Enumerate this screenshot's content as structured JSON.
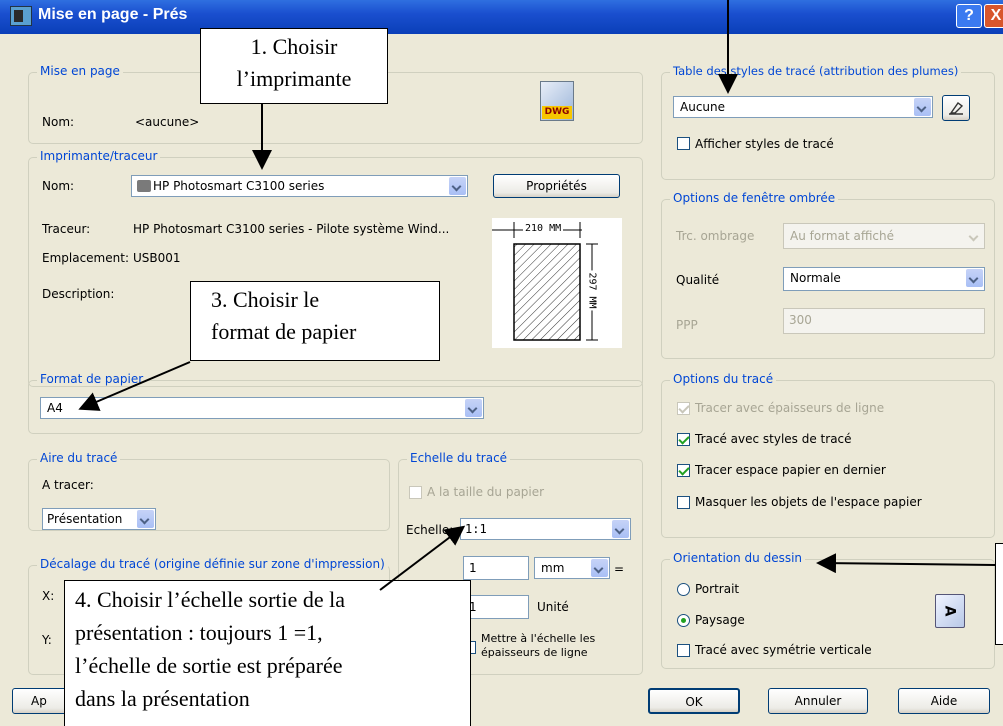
{
  "window": {
    "title": "Mise en page - Prés",
    "help_label": "?",
    "close_label": "X"
  },
  "mise_en_page": {
    "legend": "Mise en page",
    "nom_label": "Nom:",
    "nom_value": "<aucune>",
    "dwg_label": "DWG"
  },
  "imprimante": {
    "legend": "Imprimante/traceur",
    "nom_label": "Nom:",
    "nom_value": "HP Photosmart C3100 series",
    "proprietes_label": "Propriétés",
    "traceur_label": "Traceur:",
    "traceur_value": "HP Photosmart C3100 series - Pilote système Wind...",
    "emplacement_label": "Emplacement:",
    "emplacement_value": "USB001",
    "description_label": "Description:",
    "paper_width_label": "210 MM",
    "paper_height_label": "297 MM"
  },
  "format_papier": {
    "legend": "Format de papier",
    "value": "A4"
  },
  "aire_trace": {
    "legend": "Aire du tracé",
    "a_tracer_label": "A tracer:",
    "value": "Présentation"
  },
  "decalage": {
    "legend": "Décalage du tracé (origine définie sur zone d'impression)",
    "x_label": "X:",
    "y_label": "Y:"
  },
  "echelle": {
    "legend": "Echelle du tracé",
    "taille_papier_label": "A la taille du papier",
    "echelle_label": "Echelle:",
    "echelle_value": "1:1",
    "num_value": "1",
    "unit_value": "mm",
    "equals": "=",
    "den_value": "1",
    "unite_label": "Unité",
    "mettre_label_1": "Mettre à l'échelle les",
    "mettre_label_2": "épaisseurs de ligne"
  },
  "table_styles": {
    "legend": "Table des styles de tracé (attribution des plumes)",
    "value": "Aucune",
    "afficher_label": "Afficher styles de tracé"
  },
  "ombree": {
    "legend": "Options de fenêtre ombrée",
    "trc_label": "Trc. ombrage",
    "trc_value": "Au format affiché",
    "qualite_label": "Qualité",
    "qualite_value": "Normale",
    "ppp_label": "PPP",
    "ppp_value": "300"
  },
  "options_trace": {
    "legend": "Options du tracé",
    "opt1": "Tracer avec épaisseurs de ligne",
    "opt2": "Tracé avec styles de tracé",
    "opt3": "Tracer espace papier en dernier",
    "opt4": "Masquer les objets de l'espace papier"
  },
  "orientation": {
    "legend": "Orientation du dessin",
    "portrait_label": "Portrait",
    "paysage_label": "Paysage",
    "symetrie_label": "Tracé avec symétrie verticale",
    "icon_letter": "A"
  },
  "buttons": {
    "apercu_label": "Ap",
    "ok_label": "OK",
    "annuler_label": "Annuler",
    "aide_label": "Aide"
  },
  "callouts": {
    "c1_line1": "1. Choisir",
    "c1_line2": "l’imprimante",
    "c3_line1": "3. Choisir le",
    "c3_line2": "format de papier",
    "c4_line1": "4. Choisir l’échelle sortie de la",
    "c4_line2": "présentation : toujours 1 =1,",
    "c4_line3": "l’échelle de sortie est préparée",
    "c4_line4": "dans la présentation"
  }
}
